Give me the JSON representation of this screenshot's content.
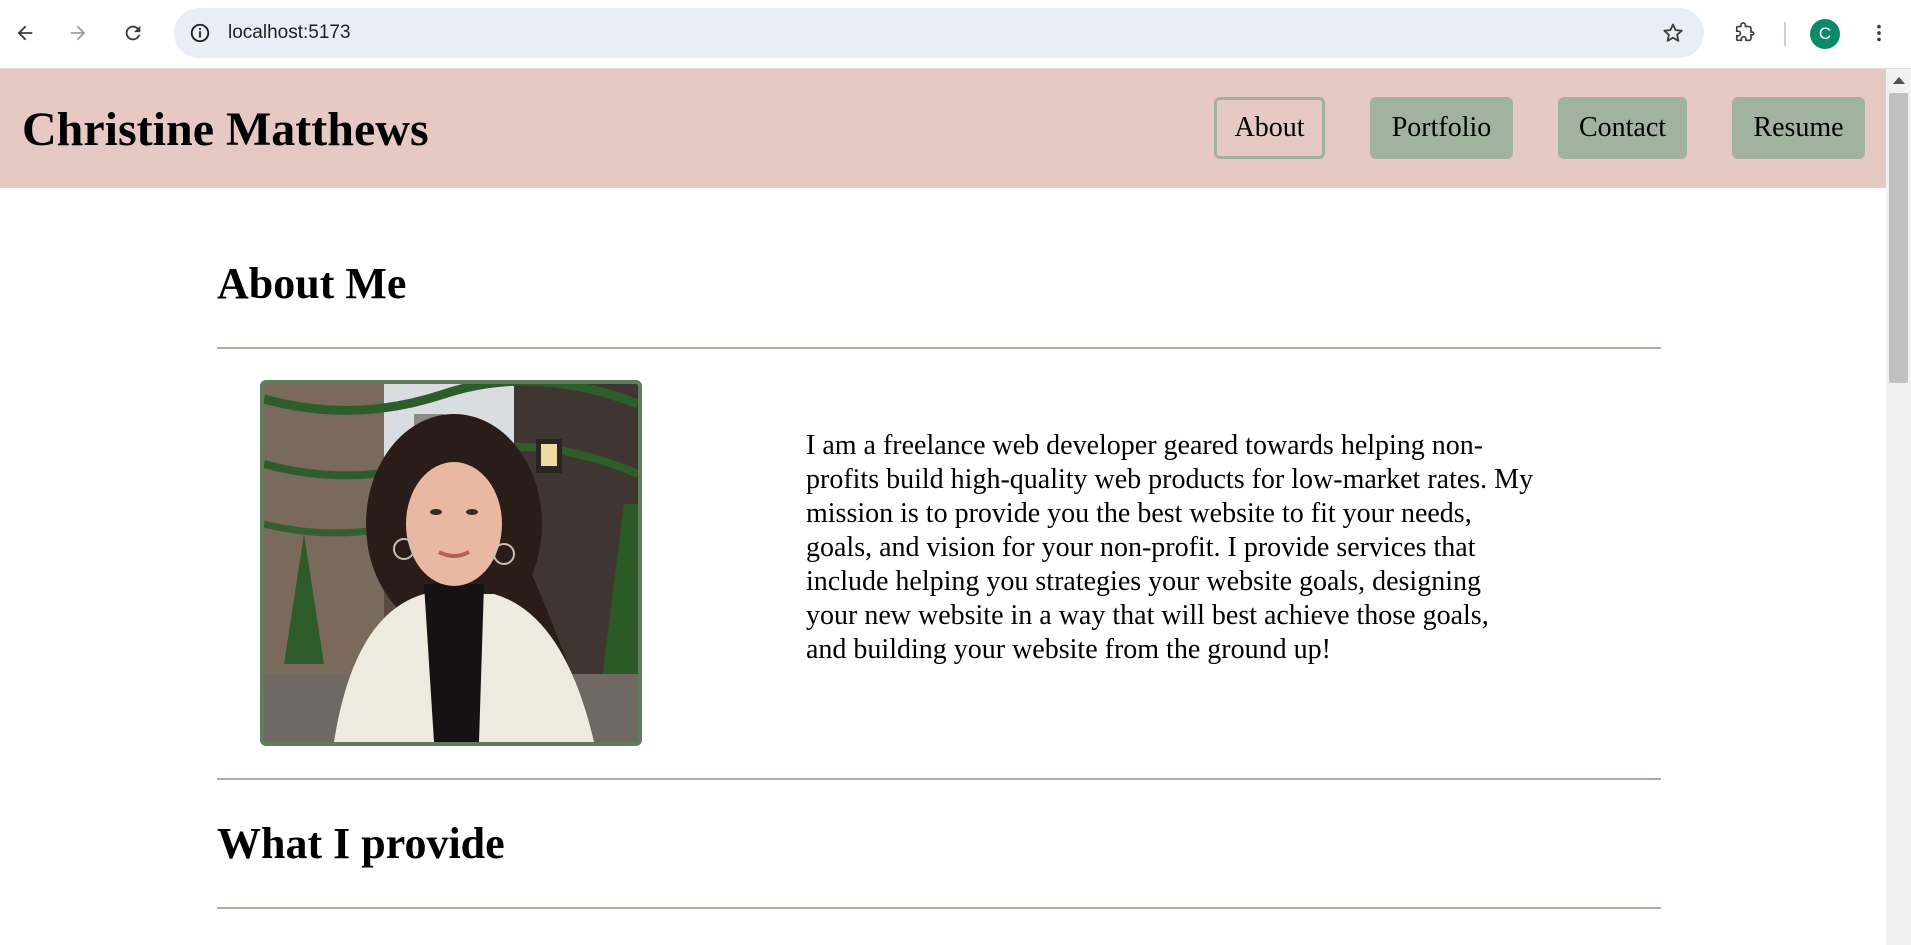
{
  "browser": {
    "url": "localhost:5173",
    "profile_initial": "C"
  },
  "site": {
    "title": "Christine Matthews",
    "nav": [
      {
        "label": "About",
        "active": true
      },
      {
        "label": "Portfolio",
        "active": false
      },
      {
        "label": "Contact",
        "active": false
      },
      {
        "label": "Resume",
        "active": false
      }
    ]
  },
  "about": {
    "heading": "About Me",
    "bio": "I am a freelance web developer geared towards helping non-profits build high-quality web products for low-market rates. My mission is to provide you the best website to fit your needs, goals, and vision for your non-profit. I provide services that include helping you strategies your website goals, designing your new website in a way that will best achieve those goals, and building your website from the ground up!"
  },
  "provide": {
    "heading": "What I provide"
  },
  "colors": {
    "header_bg": "#e5c9c2",
    "nav_button_bg": "#a1b29e",
    "rule": "#a1b29e",
    "photo_border": "#5f7d5c"
  }
}
